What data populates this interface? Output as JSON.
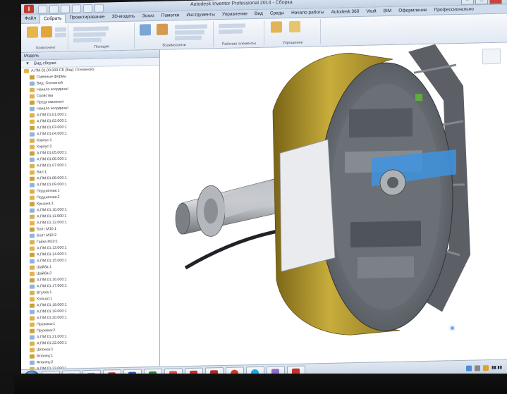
{
  "window": {
    "title": "Autodesk Inventor Professional 2014 - Сборка"
  },
  "ribbon_tabs": [
    {
      "label": "Файл",
      "active": false
    },
    {
      "label": "Собрать",
      "active": true
    },
    {
      "label": "Проектирование",
      "active": false
    },
    {
      "label": "3D-модель",
      "active": false
    },
    {
      "label": "Эскиз",
      "active": false
    },
    {
      "label": "Пометки",
      "active": false
    },
    {
      "label": "Инструменты",
      "active": false
    },
    {
      "label": "Управление",
      "active": false
    },
    {
      "label": "Вид",
      "active": false
    },
    {
      "label": "Среды",
      "active": false
    },
    {
      "label": "Начало работы",
      "active": false
    },
    {
      "label": "Autodesk 360",
      "active": false
    },
    {
      "label": "Vault",
      "active": false
    },
    {
      "label": "BIM",
      "active": false
    },
    {
      "label": "Оформление",
      "active": false
    },
    {
      "label": "Профессионально",
      "active": false
    }
  ],
  "ribbon_groups": [
    {
      "label": "Компонент"
    },
    {
      "label": "Позиция"
    },
    {
      "label": "Взаимосвязи"
    },
    {
      "label": "Рабочие элементы"
    },
    {
      "label": "Упрощение"
    }
  ],
  "browser": {
    "title": "Модель",
    "toolbar_label": "Вид сборки",
    "tree": [
      "А.ПМ.01.00.000 СБ (Вид: Основной)",
      "Сменные формы",
      "Вид: Основной",
      "Начало координат",
      "Свойства",
      "Представления",
      "Начало координат",
      "А.ПМ.01.01.000:1",
      "А.ПМ.01.02.000:1",
      "А.ПМ.01.03.000:1",
      "А.ПМ.01.04.000:1",
      "Корпус:1",
      "Корпус:2",
      "А.ПМ.01.05.000:1",
      "А.ПМ.01.06.000:1",
      "А.ПМ.01.07.000:1",
      "Вал:1",
      "А.ПМ.01.08.000:1",
      "А.ПМ.01.09.000:1",
      "Подшипник:1",
      "Подшипник:2",
      "Крышка:1",
      "А.ПМ.01.10.000:1",
      "А.ПМ.01.11.000:1",
      "А.ПМ.01.12.000:1",
      "Болт М10:1",
      "Болт М10:2",
      "Гайка М10:1",
      "А.ПМ.01.13.000:1",
      "А.ПМ.01.14.000:1",
      "А.ПМ.01.15.000:1",
      "Шайба:1",
      "Шайба:2",
      "А.ПМ.01.16.000:1",
      "А.ПМ.01.17.000:1",
      "Втулка:1",
      "Кольцо:1",
      "А.ПМ.01.18.000:1",
      "А.ПМ.01.19.000:1",
      "А.ПМ.01.20.000:1",
      "Пружина:1",
      "Пружина:2",
      "А.ПМ.01.21.000:1",
      "А.ПМ.01.22.000:1",
      "Шпонка:1",
      "Фланец:1",
      "Фланец:2",
      "А.ПМ.01.23.000:1"
    ]
  },
  "taskbar": {
    "apps": [
      "internet-explorer",
      "file-explorer",
      "media-player",
      "inventor",
      "word",
      "excel",
      "inventor-2",
      "acrobat",
      "acrobat-2",
      "opera",
      "skype",
      "paint",
      "acrobat-3"
    ]
  },
  "colors": {
    "drum_gold": "#b39a2a",
    "frame_grey": "#6e7177",
    "highlight_blue": "#3d93e0"
  }
}
